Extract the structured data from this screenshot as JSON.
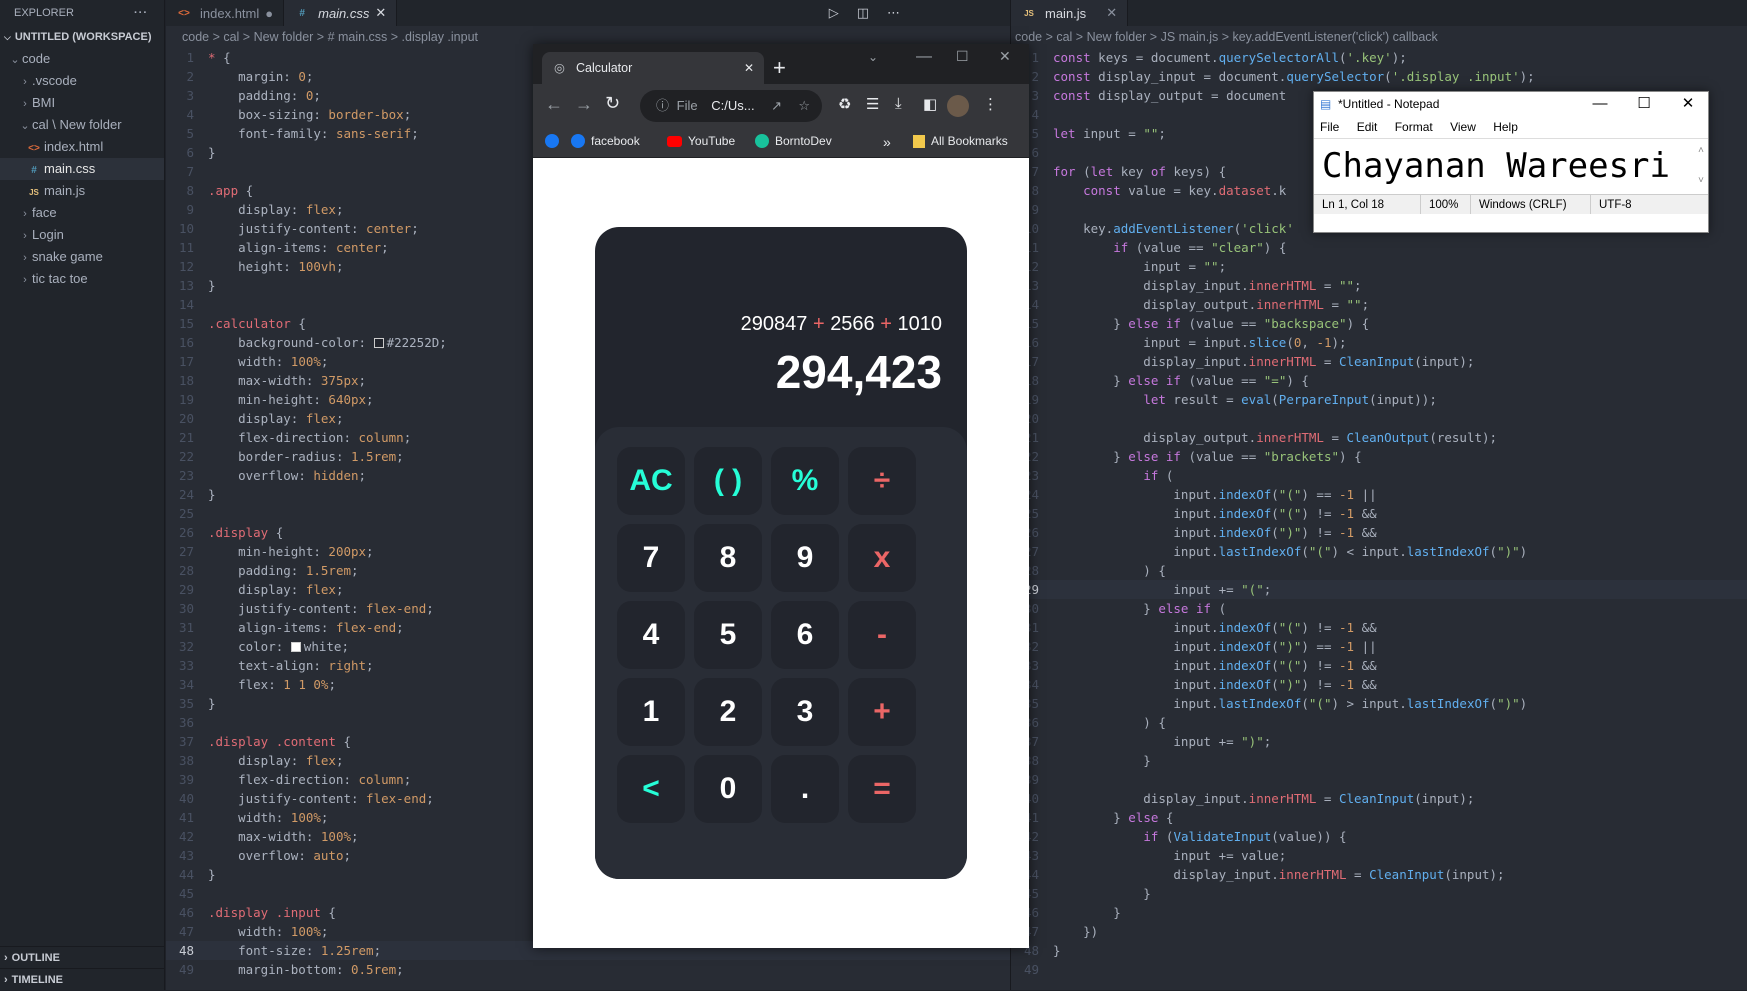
{
  "sidebar": {
    "title": "EXPLORER",
    "more": "···",
    "workspace": "UNTITLED (WORKSPACE)",
    "items": [
      {
        "label": "code"
      },
      {
        "label": ".vscode"
      },
      {
        "label": "BMI"
      },
      {
        "label": "cal \\ New folder"
      },
      {
        "label": "index.html"
      },
      {
        "label": "main.css"
      },
      {
        "label": "main.js"
      },
      {
        "label": "face"
      },
      {
        "label": "Login"
      },
      {
        "label": "snake game"
      },
      {
        "label": "tic tac toe"
      }
    ],
    "outline": "OUTLINE",
    "timeline": "TIMELINE"
  },
  "left_editor": {
    "tabs": [
      {
        "label": "index.html"
      },
      {
        "label": "main.css"
      }
    ],
    "breadcrumb": "code > cal > New folder > # main.css > .display .input"
  },
  "right_editor": {
    "tabs": [
      {
        "label": "main.js"
      }
    ],
    "breadcrumb": "code > cal > New folder > JS main.js > key.addEventListener('click') callback"
  },
  "css_lines": [
    "* {",
    "    margin: 0;",
    "    padding: 0;",
    "    box-sizing: border-box;",
    "    font-family: sans-serif;",
    "}",
    "",
    ".app {",
    "    display: flex;",
    "    justify-content: center;",
    "    align-items: center;",
    "    height: 100vh;",
    "}",
    "",
    ".calculator {",
    "    background-color: #22252D;",
    "    width: 100%;",
    "    max-width: 375px;",
    "    min-height: 640px;",
    "    display: flex;",
    "    flex-direction: column;",
    "    border-radius: 1.5rem;",
    "    overflow: hidden;",
    "}",
    "",
    ".display {",
    "    min-height: 200px;",
    "    padding: 1.5rem;",
    "    display: flex;",
    "    justify-content: flex-end;",
    "    align-items: flex-end;",
    "    color: white;",
    "    text-align: right;",
    "    flex: 1 1 0%;",
    "}",
    "",
    ".display .content {",
    "    display: flex;",
    "    flex-direction: column;",
    "    justify-content: flex-end;",
    "    width: 100%;",
    "    max-width: 100%;",
    "    overflow: auto;",
    "}",
    "",
    ".display .input {",
    "    width: 100%;",
    "    font-size: 1.25rem;",
    "    margin-bottom: 0.5rem;"
  ],
  "js_lines": [
    "const keys = document.querySelectorAll('.key');",
    "const display_input = document.querySelector('.display .input');",
    "const display_output = document",
    "",
    "let input = \"\";",
    "",
    "for (let key of keys) {",
    "    const value = key.dataset.k",
    "",
    "    key.addEventListener('click'",
    "        if (value == \"clear\") {",
    "            input = \"\";",
    "            display_input.innerHTML = \"\";",
    "            display_output.innerHTML = \"\";",
    "        } else if (value == \"backspace\") {",
    "            input = input.slice(0, -1);",
    "            display_input.innerHTML = CleanInput(input);",
    "        } else if (value == \"=\") {",
    "            let result = eval(PerpareInput(input));",
    "",
    "            display_output.innerHTML = CleanOutput(result);",
    "        } else if (value == \"brackets\") {",
    "            if (",
    "                input.indexOf(\"(\") == -1 ||",
    "                input.indexOf(\"(\") != -1 &&",
    "                input.indexOf(\")\") != -1 &&",
    "                input.lastIndexOf(\"(\") < input.lastIndexOf(\")\")",
    "            ) {",
    "                input += \"(\";",
    "            } else if (",
    "                input.indexOf(\"(\") != -1 &&",
    "                input.indexOf(\")\") == -1 ||",
    "                input.indexOf(\"(\") != -1 &&",
    "                input.indexOf(\")\") != -1 &&",
    "                input.lastIndexOf(\"(\") > input.lastIndexOf(\")\")",
    "            ) {",
    "                input += \")\";",
    "            }",
    "",
    "            display_input.innerHTML = CleanInput(input);",
    "        } else {",
    "            if (ValidateInput(value)) {",
    "                input += value;",
    "                display_input.innerHTML = CleanInput(input);",
    "            }",
    "        }",
    "    })",
    "}",
    ""
  ],
  "browser": {
    "tab_title": "Calculator",
    "new_tab": "+",
    "address": "C:/Us...",
    "address_scheme": "File",
    "bookmarks": [
      {
        "label": "facebook"
      },
      {
        "label": "YouTube"
      },
      {
        "label": "BorntoDev"
      }
    ],
    "more_bookmarks": "»",
    "all_bookmarks": "All Bookmarks"
  },
  "calculator": {
    "input_parts": [
      "290847",
      "+",
      "2566",
      "+",
      "1010"
    ],
    "output": "294,423",
    "keys": [
      "AC",
      "( )",
      "%",
      "÷",
      "7",
      "8",
      "9",
      "x",
      "4",
      "5",
      "6",
      "-",
      "1",
      "2",
      "3",
      "+",
      "<",
      "0",
      ".",
      "="
    ]
  },
  "notepad": {
    "title": "*Untitled - Notepad",
    "menu": [
      "File",
      "Edit",
      "Format",
      "View",
      "Help"
    ],
    "text": "Chayanan Wareesri",
    "status": [
      "Ln 1, Col 18",
      "100%",
      "Windows (CRLF)",
      "UTF-8"
    ]
  },
  "colors": {
    "accent_teal": "#26fed7",
    "accent_red": "#eb6666",
    "calc_bg": "#22252D"
  }
}
